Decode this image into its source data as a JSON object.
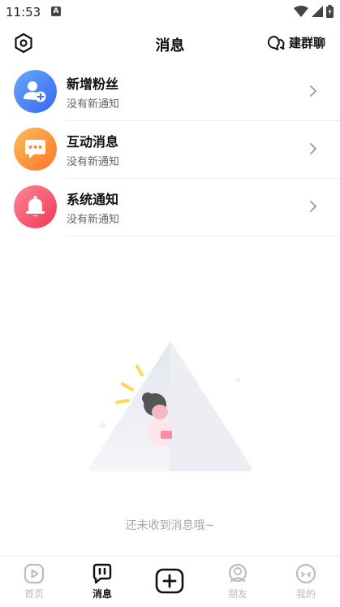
{
  "status_bar": {
    "time": "11:53",
    "indicator": "A"
  },
  "header": {
    "title": "消息",
    "group_chat_label": "建群聊"
  },
  "messages": [
    {
      "title": "新增粉丝",
      "subtitle": "没有新通知",
      "icon": "user-plus-icon",
      "color_start": "#5a9cff",
      "color_end": "#3b6ff2"
    },
    {
      "title": "互动消息",
      "subtitle": "没有新通知",
      "icon": "chat-bubble-icon",
      "color_start": "#ffb155",
      "color_end": "#ff7e2e"
    },
    {
      "title": "系统通知",
      "subtitle": "没有新通知",
      "icon": "bell-icon",
      "color_start": "#ff7a8a",
      "color_end": "#f2405a"
    }
  ],
  "empty_state": {
    "text": "还未收到消息哦~"
  },
  "bottom_nav": {
    "items": [
      {
        "label": "首页",
        "icon": "play-icon"
      },
      {
        "label": "消息",
        "icon": "message-icon"
      },
      {
        "label": "",
        "icon": "plus-box-icon"
      },
      {
        "label": "朋友",
        "icon": "friends-icon"
      },
      {
        "label": "我的",
        "icon": "profile-icon"
      }
    ],
    "active": "消息"
  }
}
